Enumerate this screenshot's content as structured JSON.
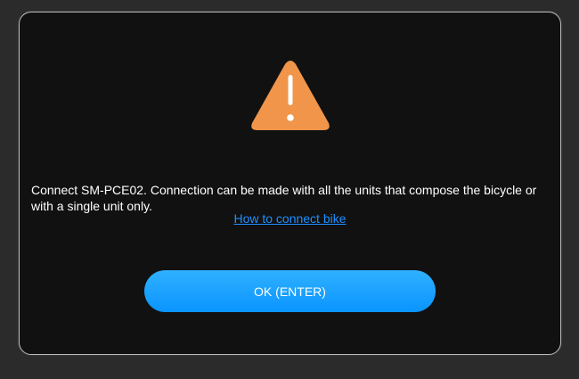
{
  "dialog": {
    "icon": "warning-triangle-icon",
    "icon_color": "#f0954a",
    "message": "Connect SM-PCE02. Connection can be made with all the units that compose the bicycle or with a single unit only.",
    "link_text": "How to connect bike",
    "ok_label": "OK (ENTER)",
    "accent_color": "#1e8fff"
  }
}
